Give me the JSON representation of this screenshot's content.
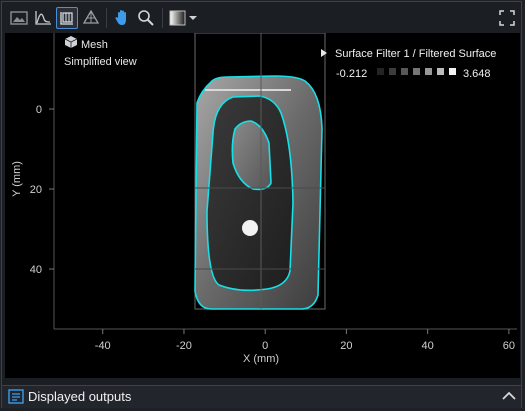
{
  "toolbar": {
    "items": [
      {
        "icon": "image-view-icon"
      },
      {
        "icon": "profile-view-icon"
      },
      {
        "icon": "surface-view-icon",
        "active": true
      },
      {
        "icon": "3d-view-icon"
      },
      {
        "icon": "pan-hand-icon",
        "active": true
      },
      {
        "icon": "zoom-icon"
      },
      {
        "icon": "colormap-icon"
      },
      {
        "icon": "chevron-down-icon"
      },
      {
        "icon": "fullscreen-icon"
      }
    ]
  },
  "viewport": {
    "mesh_label": "Mesh",
    "view_mode": "Simplified view",
    "filter_title": "Surface Filter 1 / Filtered Surface",
    "range_min": "-0.212",
    "range_max": "3.648",
    "xlabel": "X (mm)",
    "ylabel": "Y (mm)",
    "x_ticks": [
      "-40",
      "-20",
      "0",
      "20",
      "40",
      "60"
    ],
    "y_ticks": [
      "0",
      "20",
      "40"
    ],
    "x_tick_values": [
      -40,
      -20,
      0,
      20,
      40,
      60
    ],
    "y_tick_values": [
      0,
      20,
      40
    ],
    "xlim": [
      -52,
      62
    ],
    "ylim_top": -17,
    "ylim_bottom": 55,
    "accent_color": "#16e0e8"
  },
  "footer": {
    "label": "Displayed outputs"
  }
}
